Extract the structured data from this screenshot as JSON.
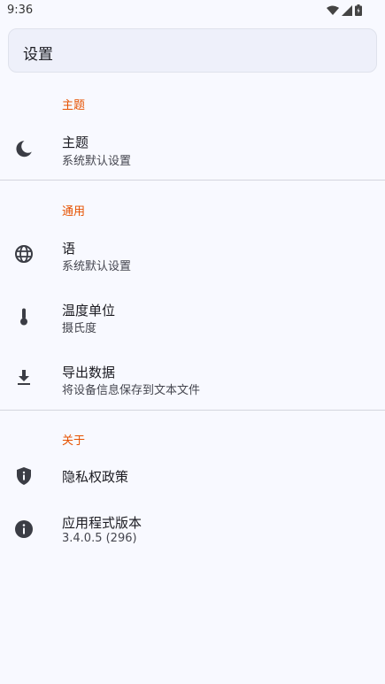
{
  "status": {
    "time": "9:36"
  },
  "search": {
    "label": "设置"
  },
  "sections": {
    "theme": {
      "header": "主题",
      "theme_item": {
        "title": "主题",
        "subtitle": "系统默认设置",
        "icon": "moon-icon"
      }
    },
    "general": {
      "header": "通用",
      "language": {
        "title": "语",
        "subtitle": "系统默认设置",
        "icon": "globe-icon"
      },
      "temperature": {
        "title": "温度单位",
        "subtitle": "摄氏度",
        "icon": "thermometer-icon"
      },
      "export": {
        "title": "导出数据",
        "subtitle": "将设备信息保存到文本文件",
        "icon": "download-icon"
      }
    },
    "about": {
      "header": "关于",
      "privacy": {
        "title": "隐私权政策",
        "icon": "shield-icon"
      },
      "version": {
        "title": "应用程式版本",
        "subtitle": "3.4.0.5 (296)",
        "icon": "info-icon"
      }
    }
  },
  "colors": {
    "accent": "#e65100",
    "background": "#f8f9ff",
    "icon": "#3b3d45"
  }
}
